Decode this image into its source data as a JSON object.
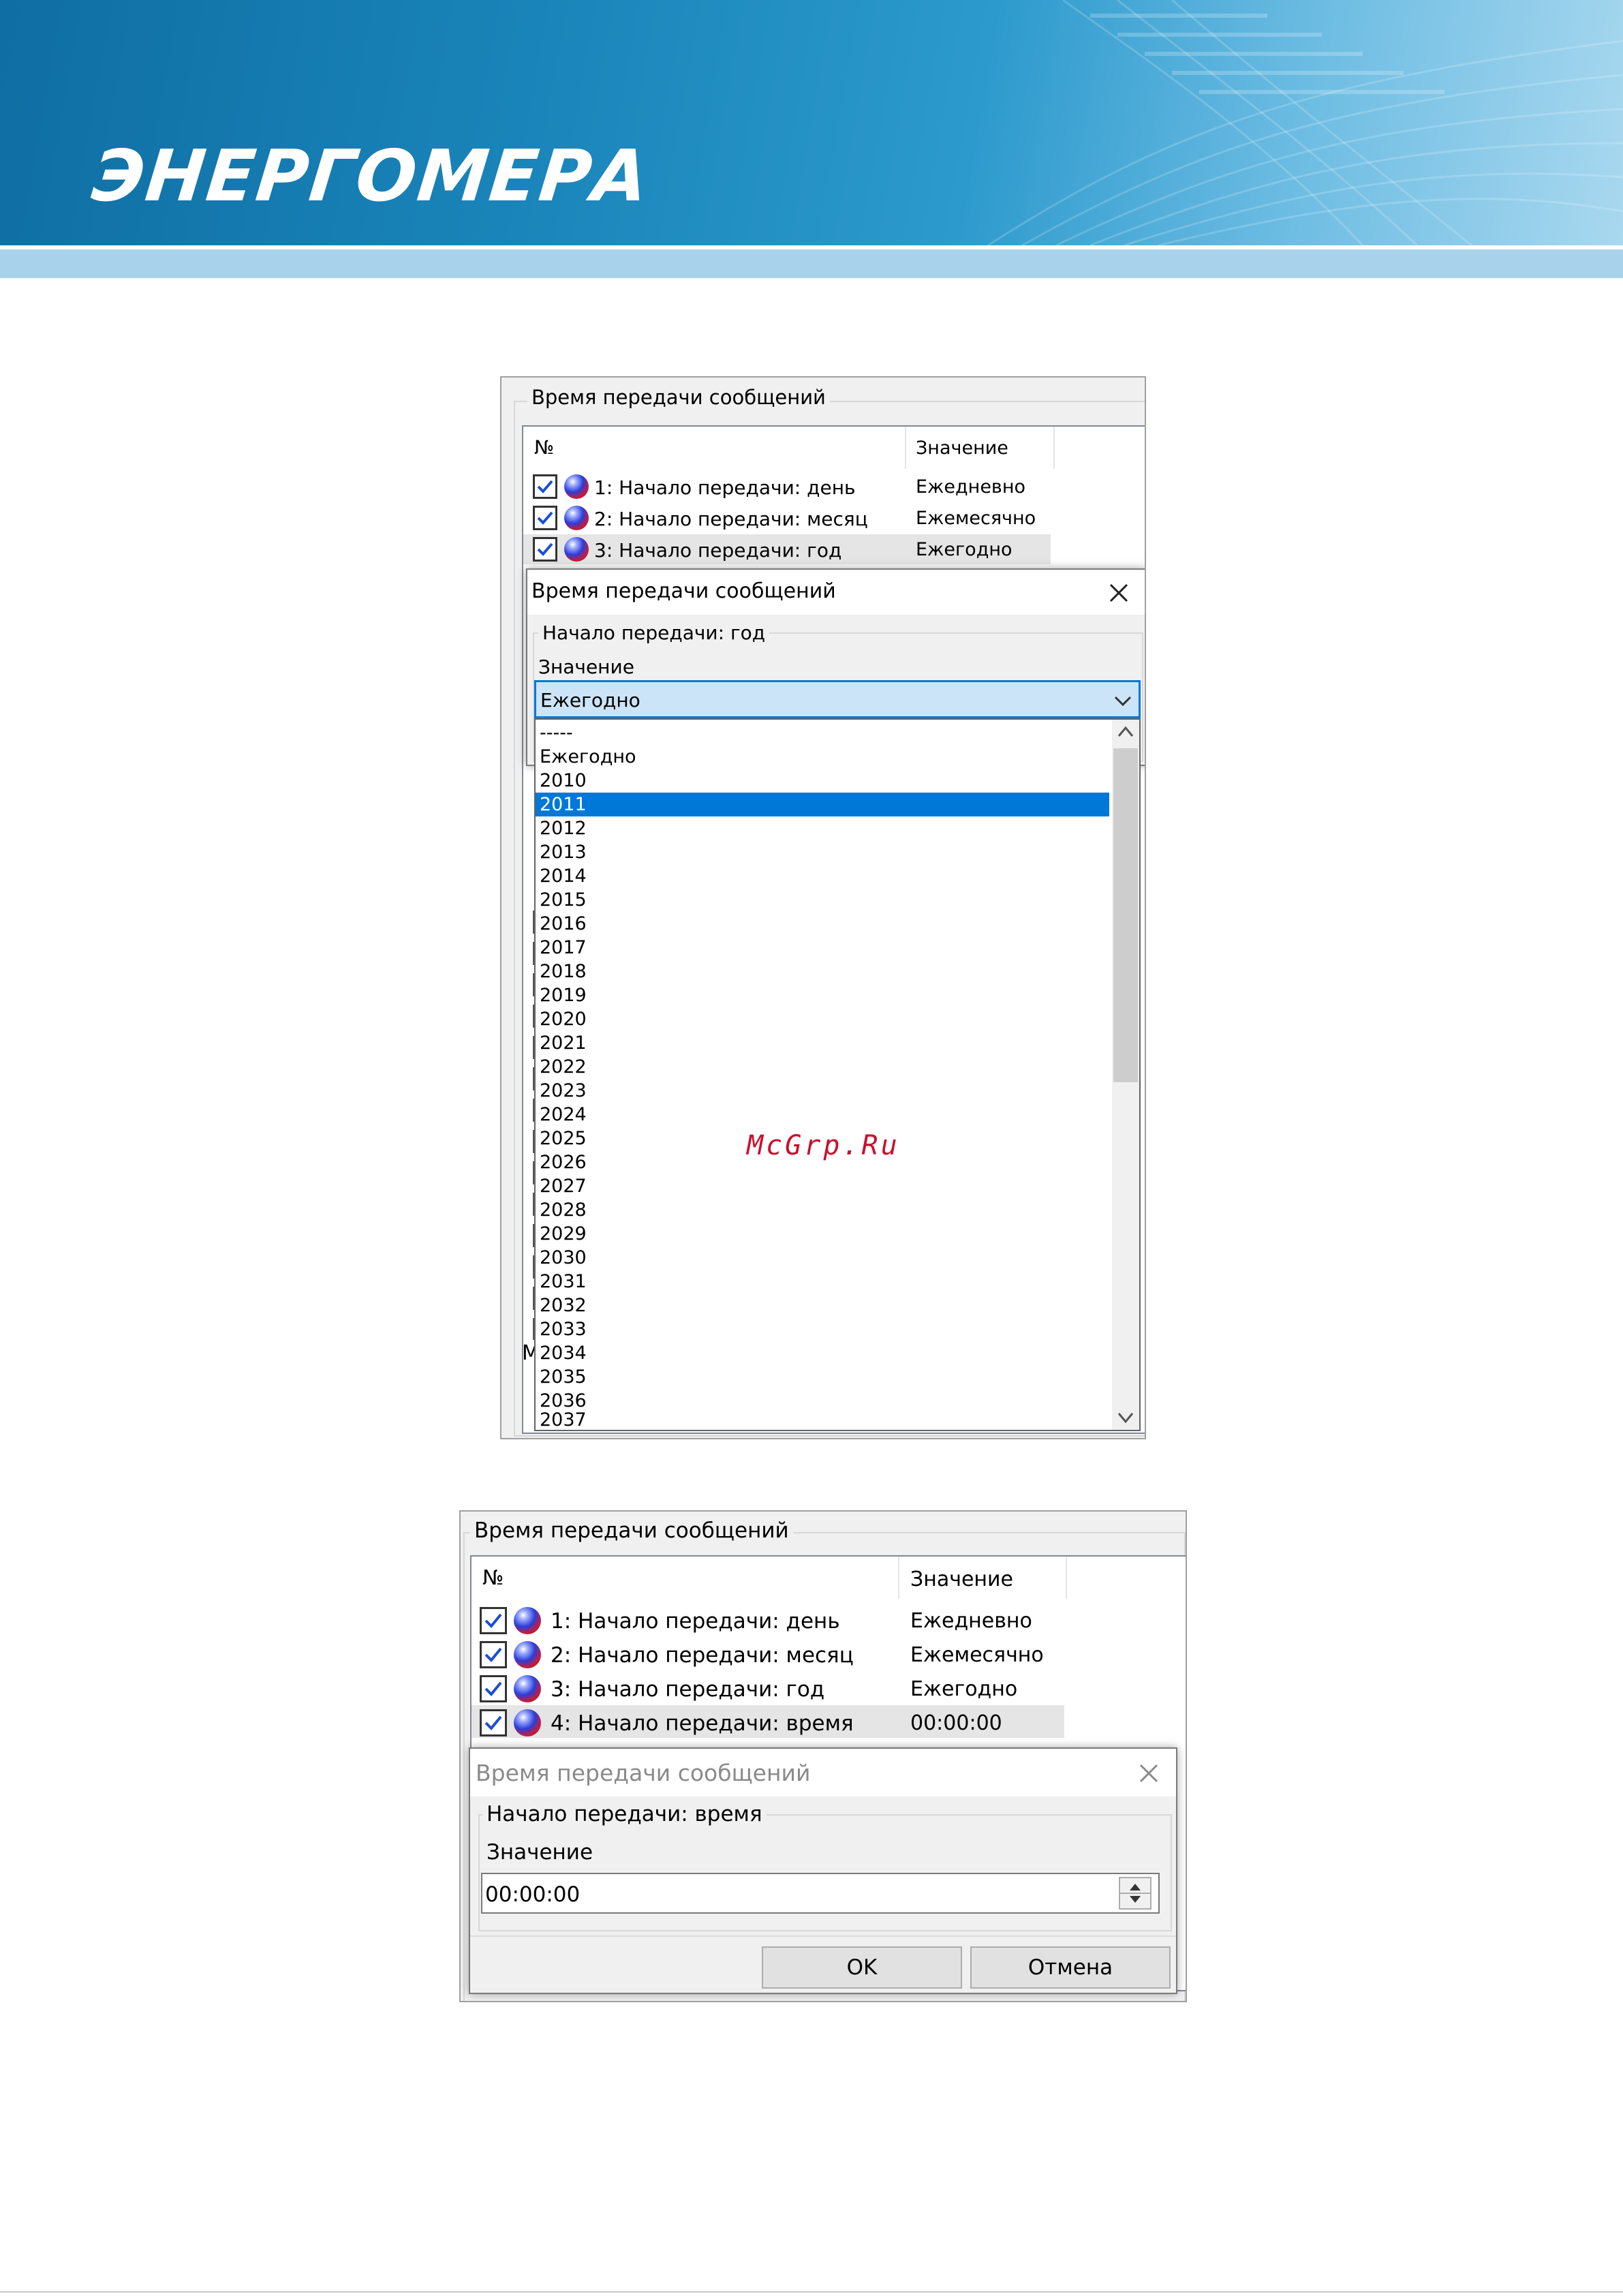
{
  "brand": {
    "logo_text": "ЭНЕРГОМЕРА"
  },
  "shot1": {
    "group_title": "Время передачи сообщений",
    "columns": {
      "num": "№",
      "value": "Значение"
    },
    "rows": [
      {
        "label": "1: Начало передачи: день",
        "value": "Ежедневно"
      },
      {
        "label": "2: Начало передачи: месяц",
        "value": "Ежемесячно"
      },
      {
        "label": "3: Начало передачи: год",
        "value": "Ежегодно"
      }
    ],
    "dialog": {
      "title": "Время передачи сообщений",
      "group_title": "Начало передачи: год",
      "field_label": "Значение",
      "selected_value": "Ежегодно",
      "options": [
        "-----",
        "Ежегодно",
        "2010",
        "2011",
        "2012",
        "2013",
        "2014",
        "2015",
        "2016",
        "2017",
        "2018",
        "2019",
        "2020",
        "2021",
        "2022",
        "2023",
        "2024",
        "2025",
        "2026",
        "2027",
        "2028",
        "2029",
        "2030",
        "2031",
        "2032",
        "2033",
        "2034",
        "2035",
        "2036",
        "2037"
      ],
      "highlighted_option": "2011"
    },
    "background_glimpse": "М"
  },
  "watermark": "McGrp.Ru",
  "shot2": {
    "group_title": "Время передачи сообщений",
    "columns": {
      "num": "№",
      "value": "Значение"
    },
    "rows": [
      {
        "label": "1: Начало передачи: день",
        "value": "Ежедневно"
      },
      {
        "label": "2: Начало передачи: месяц",
        "value": "Ежемесячно"
      },
      {
        "label": "3: Начало передачи: год",
        "value": "Ежегодно"
      },
      {
        "label": "4: Начало передачи: время",
        "value": "00:00:00"
      }
    ],
    "dialog": {
      "title": "Время передачи сообщений",
      "group_title": "Начало передачи: время",
      "field_label": "Значение",
      "value": "00:00:00",
      "ok_label": "OK",
      "cancel_label": "Отмена"
    }
  },
  "colors": {
    "accent": "#0078d7",
    "banner": "#1a86bb",
    "watermark": "#c8102e"
  }
}
